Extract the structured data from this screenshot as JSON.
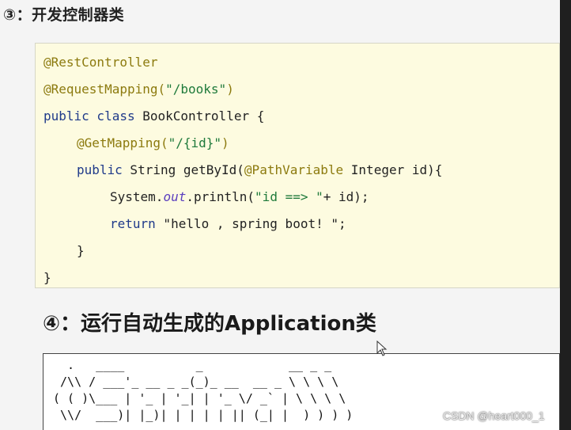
{
  "step3": {
    "heading": "③：开发控制器类"
  },
  "code": {
    "l1": {
      "ann": "@RestController"
    },
    "l2": {
      "ann": "@RequestMapping(",
      "str": "\"/books\"",
      "tail": ")"
    },
    "l3": {
      "kw": "public class",
      "rest": " BookController {"
    },
    "l4": {
      "ann": "@GetMapping(",
      "str": "\"/{id}\"",
      "tail": ")"
    },
    "l5": {
      "kw": "public",
      "mid": " String getById(",
      "ann": "@PathVariable",
      "rest": " Integer id){"
    },
    "l6": {
      "pre": "System.",
      "field": "out",
      "mid": ".println(",
      "str": "\"id ==> \"",
      "rest": "+ id);"
    },
    "l7": {
      "kw": "return",
      "rest": " \"hello , spring boot! \";"
    },
    "l8": {
      "text": "}"
    },
    "l9": {
      "text": "}"
    }
  },
  "step4": {
    "heading": "④：运行自动生成的Application类"
  },
  "banner": {
    "lines": [
      "  .   ____          _            __ _ _",
      " /\\\\ / ___'_ __ _ _(_)_ __  __ _ \\ \\ \\ \\",
      "( ( )\\___ | '_ | '_| | '_ \\/ _` | \\ \\ \\ \\",
      " \\\\/  ___)| |_)| | | | | || (_| |  ) ) ) )"
    ]
  },
  "watermark": "CSDN @heart000_1",
  "colors": {
    "annotation": "#8c7a0e",
    "keyword": "#1f3a8a",
    "string": "#1f7a3b",
    "code_bg": "#fdfbe0"
  }
}
